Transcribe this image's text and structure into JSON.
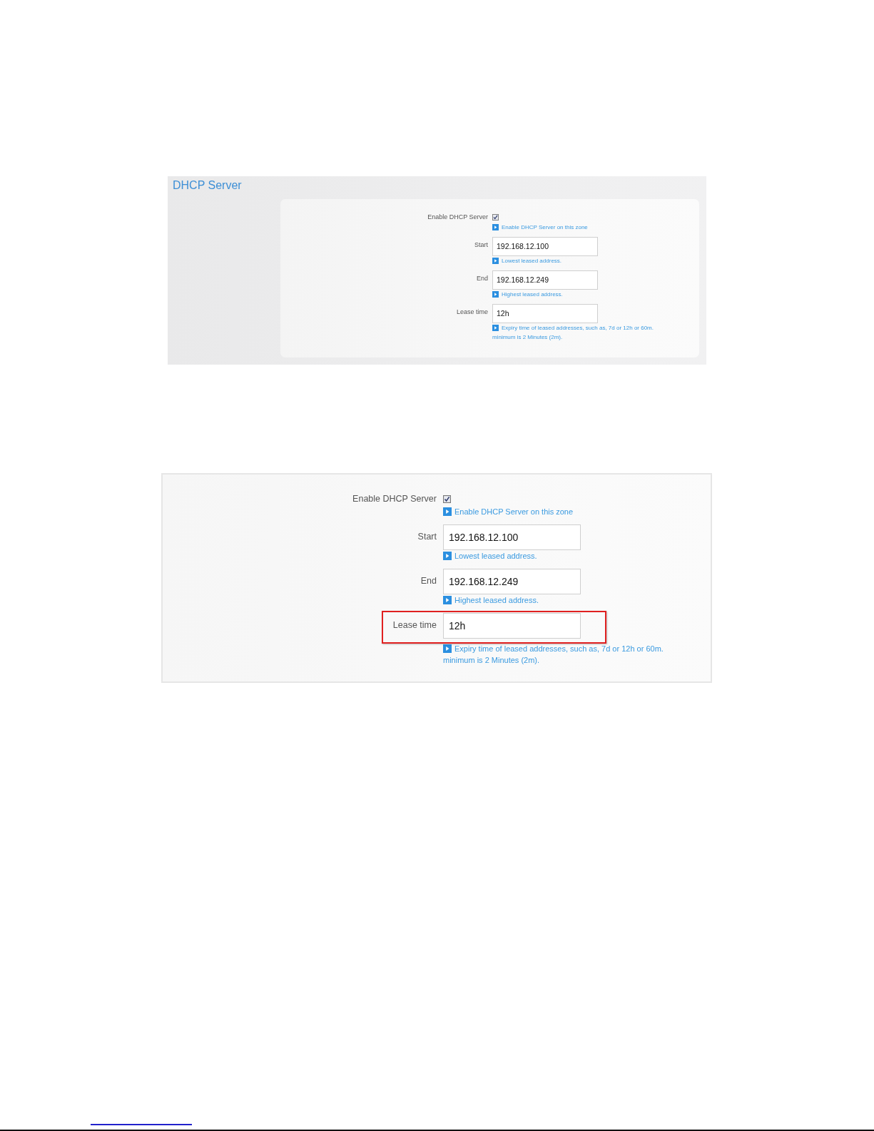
{
  "screenshots": [
    {
      "title": "DHCP Server",
      "fields": [
        {
          "kind": "checkbox",
          "label": "Enable DHCP Server",
          "checked": true,
          "highlighted": false,
          "hint": [
            "Enable DHCP Server on this zone"
          ]
        },
        {
          "kind": "text",
          "label": "Start",
          "value": "192.168.12.100",
          "highlighted": false,
          "hint": [
            "Lowest leased address."
          ]
        },
        {
          "kind": "text",
          "label": "End",
          "value": "192.168.12.249",
          "highlighted": false,
          "hint": [
            "Highest leased address."
          ]
        },
        {
          "kind": "text",
          "label": "Lease time",
          "value": "12h",
          "highlighted": false,
          "hint": [
            "Expiry time of leased addresses, such as, 7d or 12h or 60m.",
            "minimum is 2 Minutes (2m)."
          ]
        }
      ]
    },
    {
      "fields": [
        {
          "kind": "checkbox",
          "label": "Enable DHCP Server",
          "checked": true,
          "highlighted": false,
          "hint": [
            "Enable DHCP Server on this zone"
          ]
        },
        {
          "kind": "text",
          "label": "Start",
          "value": "192.168.12.100",
          "highlighted": false,
          "hint": [
            "Lowest leased address."
          ]
        },
        {
          "kind": "text",
          "label": "End",
          "value": "192.168.12.249",
          "highlighted": false,
          "hint": [
            "Highest leased address."
          ]
        },
        {
          "kind": "text",
          "label": "Lease time",
          "value": "12h",
          "highlighted": true,
          "hint": [
            "Expiry time of leased addresses, such as, 7d or 12h or 60m.",
            "minimum is 2 Minutes (2m)."
          ]
        }
      ]
    }
  ]
}
